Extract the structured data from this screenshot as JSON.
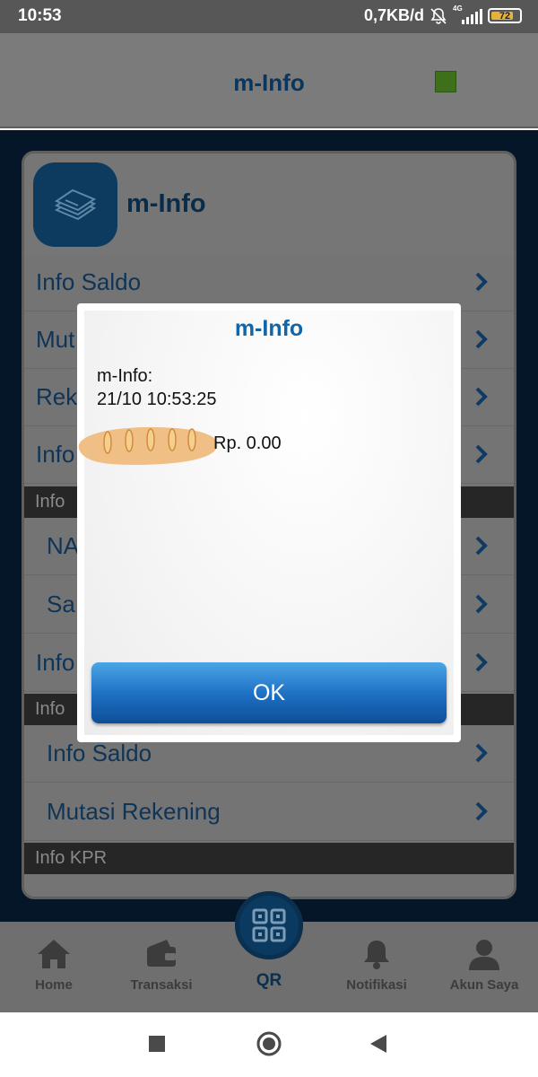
{
  "status_bar": {
    "time": "10:53",
    "speed": "0,7KB/d",
    "network": "4G",
    "battery": "72"
  },
  "header": {
    "title": "m-Info"
  },
  "card": {
    "title": "m-Info",
    "rows_top": [
      {
        "label": "Info Saldo"
      },
      {
        "label": "Mut"
      },
      {
        "label": "Rek"
      },
      {
        "label": "Info"
      }
    ],
    "section1": "Info",
    "rows_mid": [
      {
        "label": "NA"
      },
      {
        "label": "Sa"
      },
      {
        "label": "Info"
      }
    ],
    "section2": "Info",
    "rows_bottom": [
      {
        "label": "Info Saldo"
      },
      {
        "label": "Mutasi Rekening"
      }
    ],
    "section3": "Info KPR"
  },
  "dialog": {
    "title": "m-Info",
    "line1": "m-Info:",
    "line2": "21/10 10:53:25",
    "amount": "Rp. 0.00",
    "ok_label": "OK"
  },
  "bottom_nav": {
    "home": "Home",
    "transaksi": "Transaksi",
    "qr": "QR",
    "notifikasi": "Notifikasi",
    "akun": "Akun Saya"
  },
  "colors": {
    "accent_blue": "#1265a8",
    "navy": "#0b3a60",
    "indicator_green": "#3e6f1b"
  },
  "icons": [
    "bell-off-icon",
    "signal-icon",
    "battery-icon",
    "document-stack-icon",
    "chevron-right-icon",
    "home-icon",
    "wallet-icon",
    "qr-icon",
    "bell-icon",
    "user-icon",
    "stop-square-icon",
    "home-circle-icon",
    "back-triangle-icon"
  ]
}
